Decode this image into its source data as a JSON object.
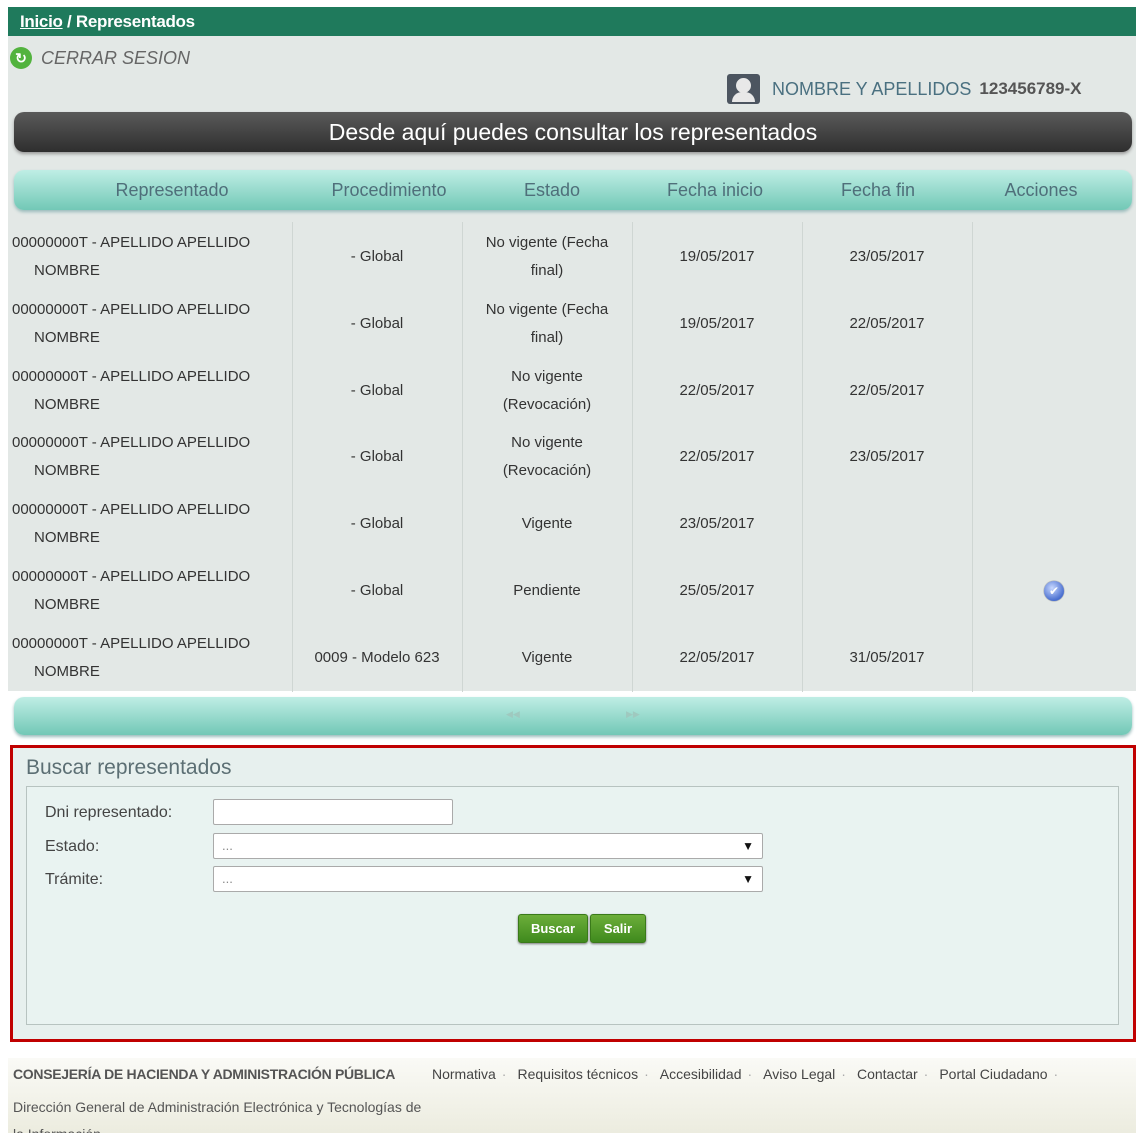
{
  "breadcrumb": {
    "home": "Inicio",
    "separator": " / ",
    "current": "Representados"
  },
  "logout": {
    "label": "CERRAR SESION"
  },
  "user": {
    "name": "NOMBRE Y APELLIDOS",
    "id": "123456789-X"
  },
  "banner": {
    "title": "Desde aquí puedes consultar los representados"
  },
  "table": {
    "columns": [
      "Representado",
      "Procedimiento",
      "Estado",
      "Fecha inicio",
      "Fecha fin",
      "Acciones"
    ],
    "rows": [
      {
        "rep_line1": "00000000T - APELLIDO APELLIDO",
        "rep_line2": "NOMBRE",
        "proc": "- Global",
        "estado_line1": "No vigente (Fecha",
        "estado_line2": "final)",
        "inicio": "19/05/2017",
        "fin": "23/05/2017"
      },
      {
        "rep_line1": "00000000T - APELLIDO APELLIDO",
        "rep_line2": "NOMBRE",
        "proc": "- Global",
        "estado_line1": "No vigente (Fecha",
        "estado_line2": "final)",
        "inicio": "19/05/2017",
        "fin": "22/05/2017"
      },
      {
        "rep_line1": "00000000T - APELLIDO APELLIDO",
        "rep_line2": "NOMBRE",
        "proc": "- Global",
        "estado_line1": "No vigente",
        "estado_line2": "(Revocación)",
        "inicio": "22/05/2017",
        "fin": "22/05/2017"
      },
      {
        "rep_line1": "00000000T - APELLIDO APELLIDO",
        "rep_line2": "NOMBRE",
        "proc": "- Global",
        "estado_line1": "No vigente",
        "estado_line2": "(Revocación)",
        "inicio": "22/05/2017",
        "fin": "23/05/2017"
      },
      {
        "rep_line1": "00000000T - APELLIDO APELLIDO",
        "rep_line2": "NOMBRE",
        "proc": "- Global",
        "estado_line1": "Vigente",
        "estado_line2": "",
        "inicio": "23/05/2017",
        "fin": ""
      },
      {
        "rep_line1": "00000000T - APELLIDO APELLIDO",
        "rep_line2": "NOMBRE",
        "proc": "- Global",
        "estado_line1": "Pendiente",
        "estado_line2": "",
        "inicio": "25/05/2017",
        "fin": "",
        "action_icon": "info-icon"
      },
      {
        "rep_line1": "00000000T - APELLIDO APELLIDO",
        "rep_line2": "NOMBRE",
        "proc": "0009 - Modelo 623",
        "estado_line1": "Vigente",
        "estado_line2": "",
        "inicio": "22/05/2017",
        "fin": "31/05/2017"
      }
    ]
  },
  "search": {
    "title": "Buscar representados",
    "dni_label": "Dni representado:",
    "dni_value": "",
    "estado_label": "Estado:",
    "estado_value": "...",
    "tramite_label": "Trámite:",
    "tramite_value": "...",
    "buscar_label": "Buscar",
    "salir_label": "Salir"
  },
  "footer": {
    "org": "CONSEJERÍA DE HACIENDA Y ADMINISTRACIÓN PÚBLICA",
    "dir": "Dirección General de Administración Electrónica y Tecnologías de la Información",
    "links": [
      "Normativa",
      "Requisitos técnicos",
      "Accesibilidad",
      "Aviso Legal",
      "Contactar",
      "Portal Ciudadano"
    ]
  },
  "colors": {
    "header_green": "#1f7a5c",
    "table_header": "#72c8b6",
    "button_green": "#4f9a28",
    "highlight_border": "#c00000"
  }
}
